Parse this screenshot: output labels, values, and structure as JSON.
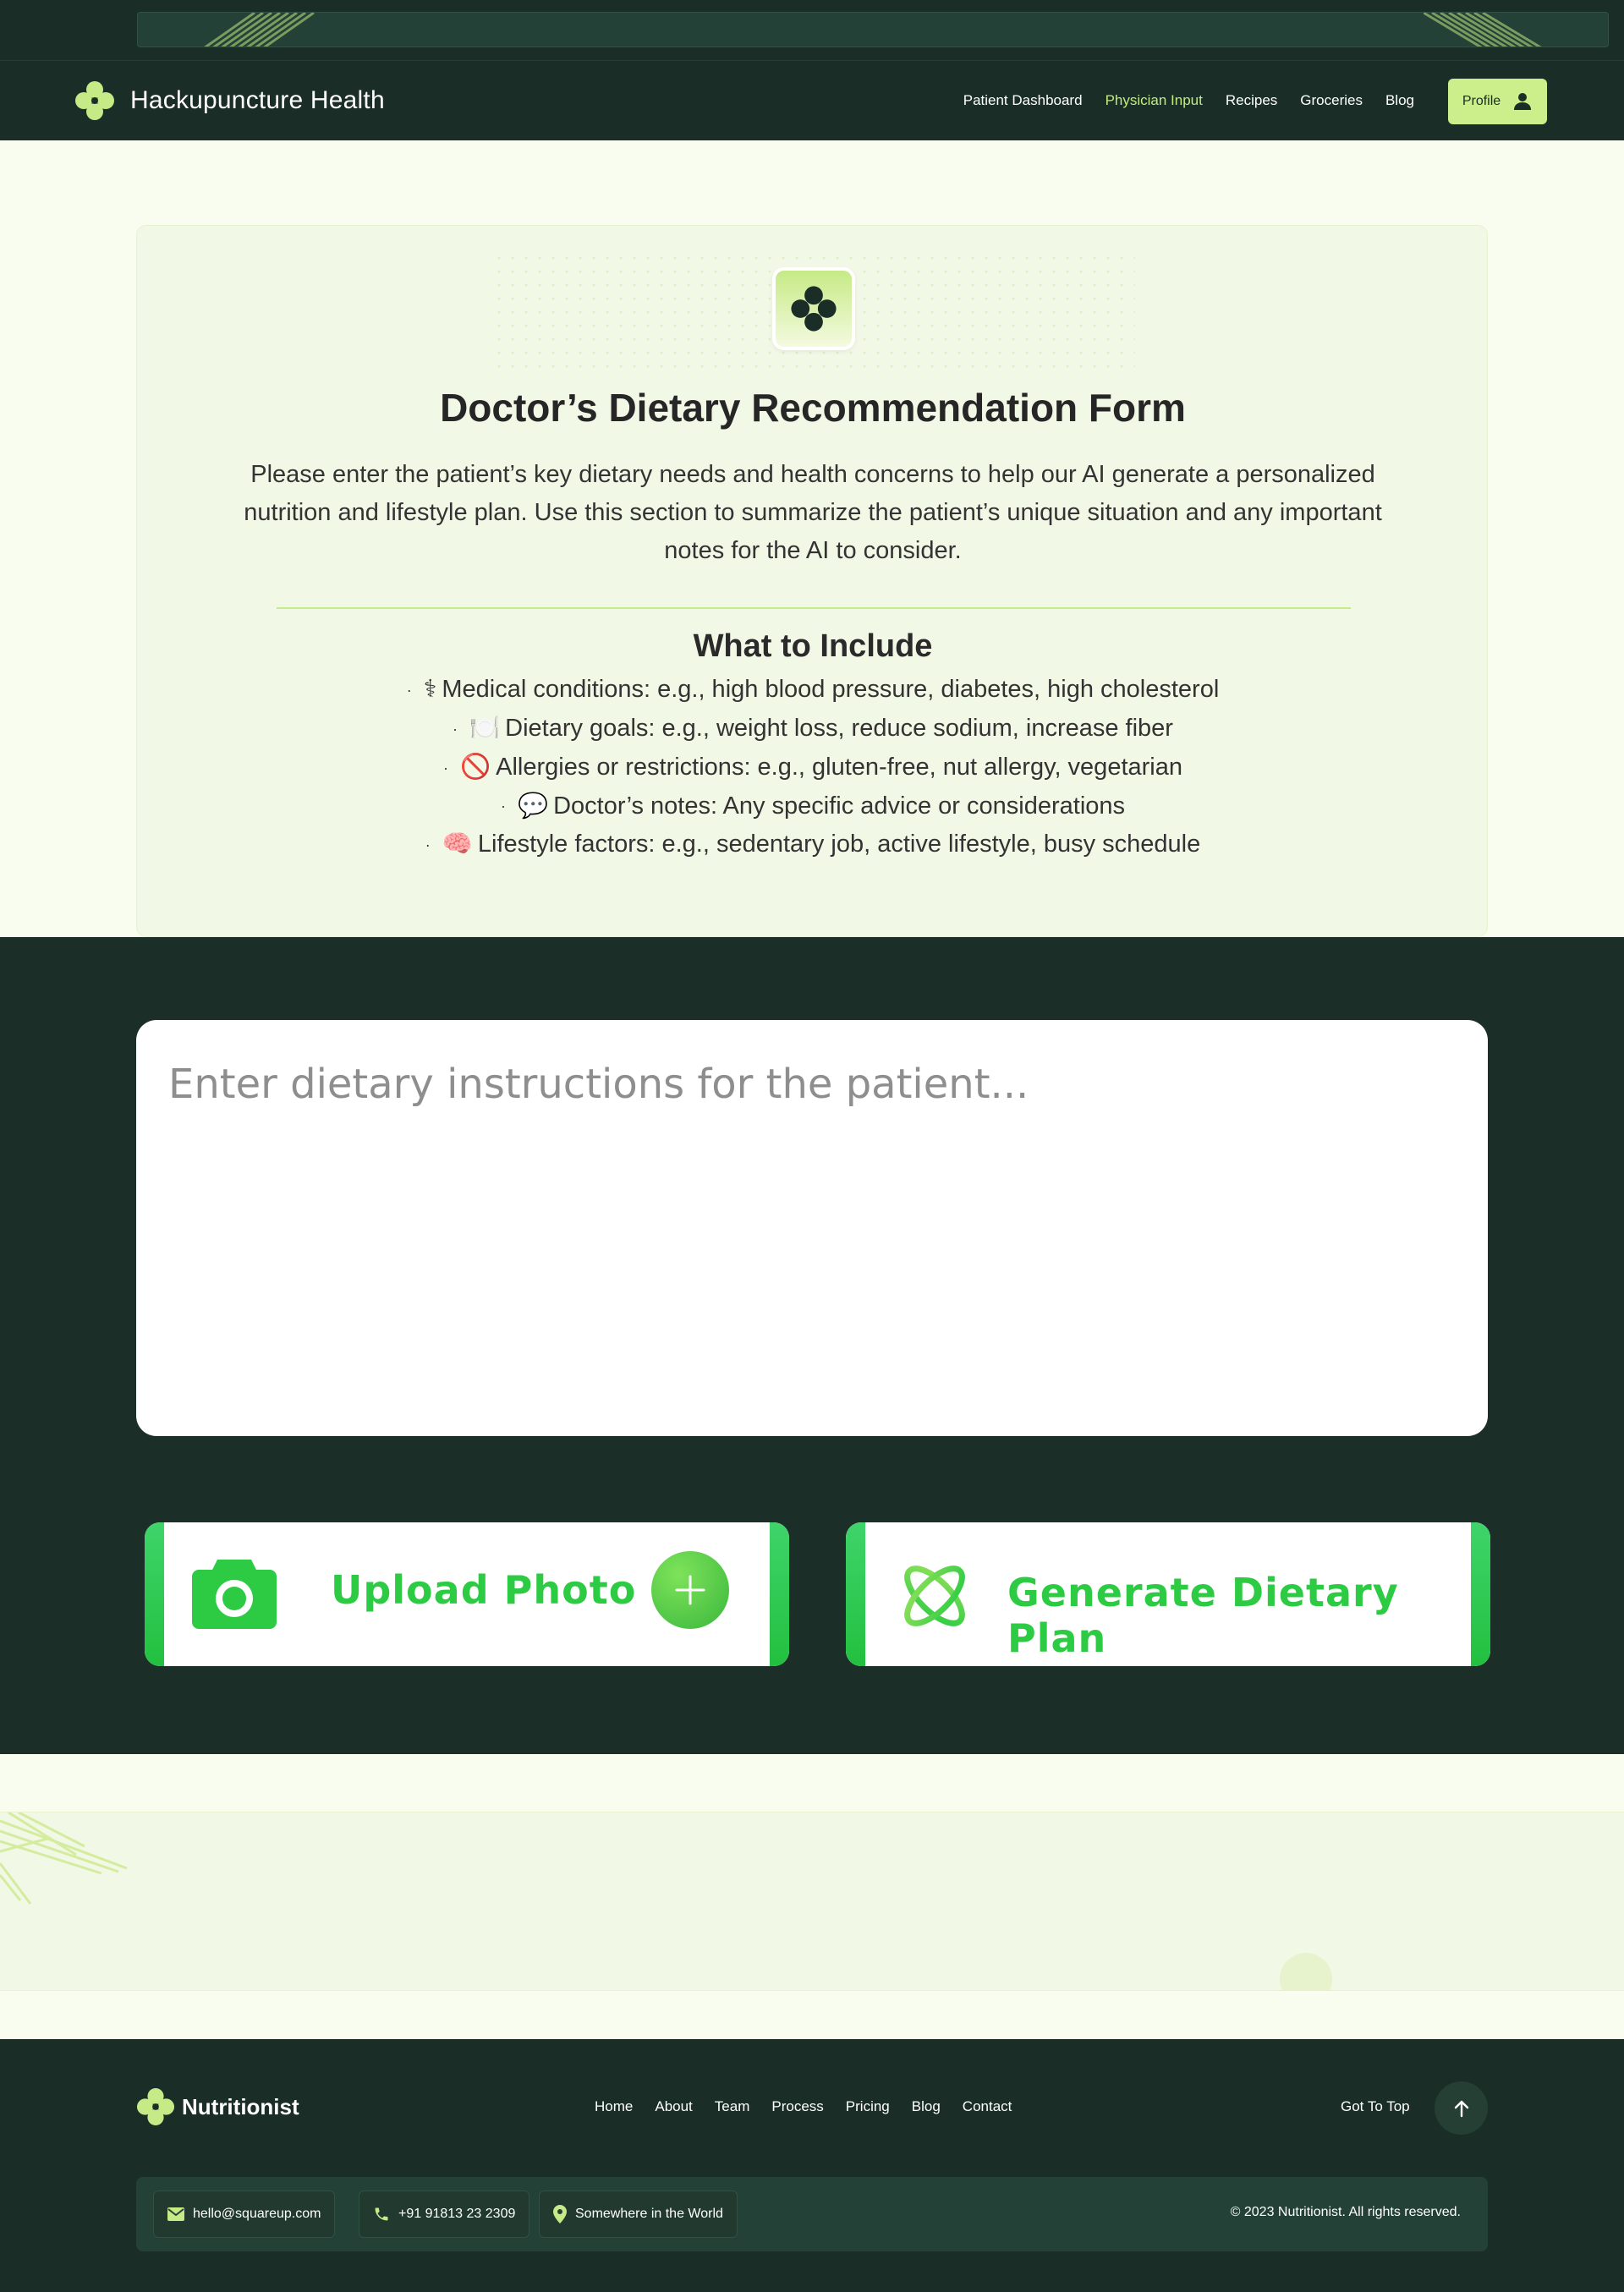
{
  "header": {
    "brand": "Hackupuncture Health",
    "nav": [
      "Patient Dashboard",
      "Physician Input",
      "Recipes",
      "Groceries",
      "Blog"
    ],
    "active_nav": "Physician Input",
    "profile_label": "Profile"
  },
  "intro": {
    "title": "Doctor’s Dietary Recommendation Form",
    "description": "Please enter the patient’s key dietary needs and health concerns to help our AI generate a personalized nutrition and lifestyle plan. Use this section to summarize the patient’s unique situation and any important notes for the AI to consider.",
    "include_title": "What to Include",
    "include_items": [
      {
        "emoji": "⚕",
        "text": "Medical conditions: e.g., high blood pressure, diabetes, high cholesterol"
      },
      {
        "emoji": "🍽️",
        "text": "Dietary goals: e.g., weight loss, reduce sodium, increase fiber"
      },
      {
        "emoji": "🚫",
        "text": "Allergies or restrictions: e.g., gluten-free, nut allergy, vegetarian"
      },
      {
        "emoji": "💬",
        "text": "Doctor’s notes: Any specific advice or considerations"
      },
      {
        "emoji": "🧠",
        "text": "Lifestyle factors: e.g., sedentary job, active lifestyle, busy schedule"
      }
    ]
  },
  "input": {
    "placeholder": "Enter dietary instructions for the patient...",
    "value": "",
    "upload_label": "Upload Photo",
    "generate_label": "Generate Dietary Plan"
  },
  "footer": {
    "brand": "Nutritionist",
    "nav": [
      "Home",
      "About",
      "Team",
      "Process",
      "Pricing",
      "Blog",
      "Contact"
    ],
    "got_to_top": "Got To Top",
    "email": "hello@squareup.com",
    "phone": "+91 91813 23 2309",
    "location": "Somewhere in the World",
    "copyright": "© 2023 Nutritionist. All rights reserved."
  },
  "colors": {
    "dark_green": "#1a2e27",
    "lime_accent": "#ccef8c",
    "action_green": "#2ccb43",
    "page_bg": "#f9fdf0"
  },
  "icons": [
    "clover-logo-icon",
    "user-icon",
    "camera-icon",
    "plus-icon",
    "atom-icon",
    "mail-icon",
    "phone-icon",
    "location-pin-icon",
    "arrow-up-icon"
  ]
}
